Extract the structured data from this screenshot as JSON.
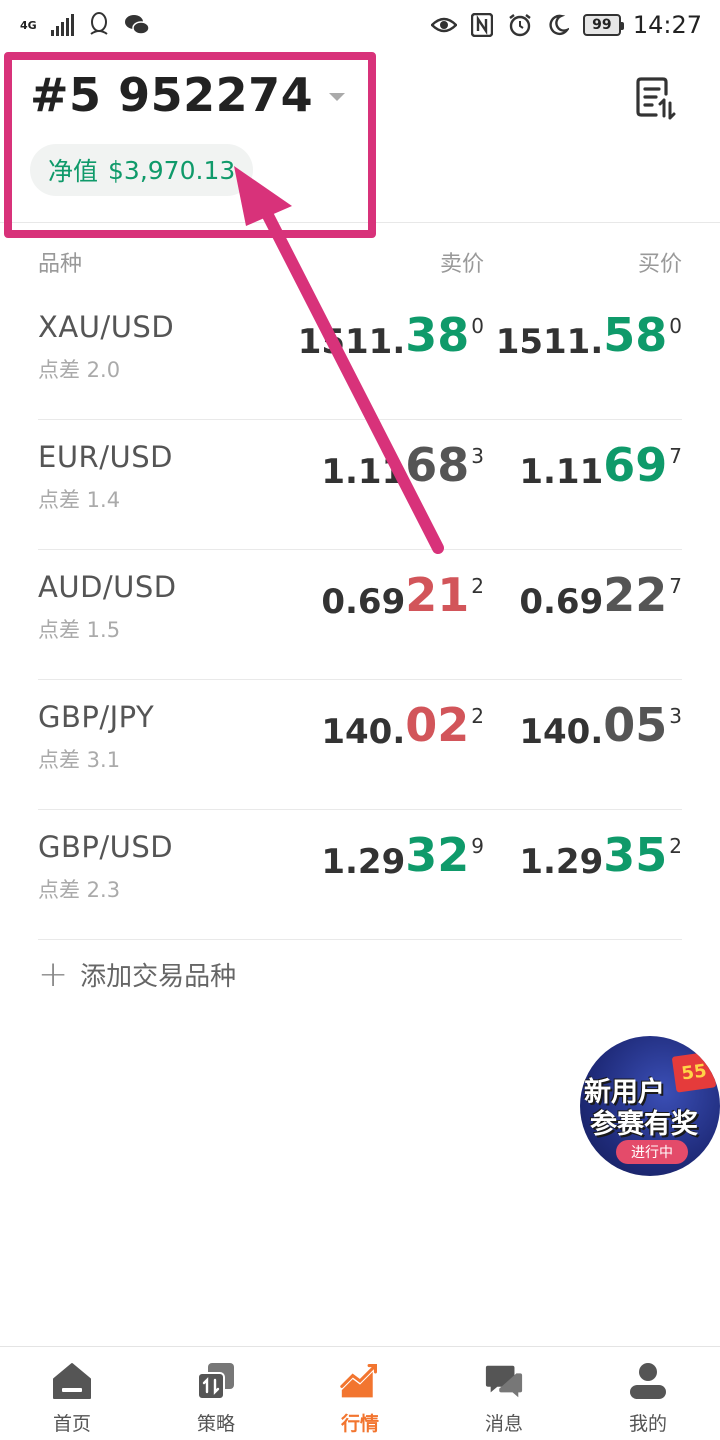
{
  "status_bar": {
    "network": "4G",
    "time": "14:27",
    "battery": "99",
    "icons": [
      "signal-icon",
      "qq-icon",
      "wechat-icon",
      "eye-icon",
      "nfc-icon",
      "alarm-icon",
      "moon-icon",
      "battery-icon"
    ]
  },
  "header": {
    "account_number": "#5 952274",
    "equity_label": "净值",
    "equity_value": "$3,970.13"
  },
  "table": {
    "columns": {
      "symbol": "品种",
      "bid": "卖价",
      "ask": "买价"
    },
    "rows": [
      {
        "symbol": "XAU/USD",
        "spread": "点差 2.0",
        "bid": {
          "base": "1511.",
          "big": "38",
          "sup": "0",
          "color": "#0f9a6a"
        },
        "ask": {
          "base": "1511.",
          "big": "58",
          "sup": "0",
          "color": "#0f9a6a"
        }
      },
      {
        "symbol": "EUR/USD",
        "spread": "点差 1.4",
        "bid": {
          "base": "1.11",
          "big": "68",
          "sup": "3",
          "color": "#555555"
        },
        "ask": {
          "base": "1.11",
          "big": "69",
          "sup": "7",
          "color": "#0f9a6a"
        }
      },
      {
        "symbol": "AUD/USD",
        "spread": "点差 1.5",
        "bid": {
          "base": "0.69",
          "big": "21",
          "sup": "2",
          "color": "#d2555a"
        },
        "ask": {
          "base": "0.69",
          "big": "22",
          "sup": "7",
          "color": "#555555"
        }
      },
      {
        "symbol": "GBP/JPY",
        "spread": "点差 3.1",
        "bid": {
          "base": "140.",
          "big": "02",
          "sup": "2",
          "color": "#d2555a"
        },
        "ask": {
          "base": "140.",
          "big": "05",
          "sup": "3",
          "color": "#555555"
        }
      },
      {
        "symbol": "GBP/USD",
        "spread": "点差 2.3",
        "bid": {
          "base": "1.29",
          "big": "32",
          "sup": "9",
          "color": "#0f9a6a"
        },
        "ask": {
          "base": "1.29",
          "big": "35",
          "sup": "2",
          "color": "#0f9a6a"
        }
      }
    ],
    "add_label": "添加交易品种"
  },
  "promo": {
    "line1": "新用户",
    "line2": "参赛有奖",
    "tag": "55",
    "status": "进行中"
  },
  "bottom_nav": {
    "items": [
      {
        "label": "首页",
        "icon": "home-icon"
      },
      {
        "label": "策略",
        "icon": "strategy-icon"
      },
      {
        "label": "行情",
        "icon": "market-icon",
        "active": true
      },
      {
        "label": "消息",
        "icon": "message-icon"
      },
      {
        "label": "我的",
        "icon": "profile-icon"
      }
    ]
  },
  "colors": {
    "up": "#0f9a6a",
    "down": "#d2555a",
    "accent": "#f2752f",
    "annotation": "#d8327a"
  }
}
